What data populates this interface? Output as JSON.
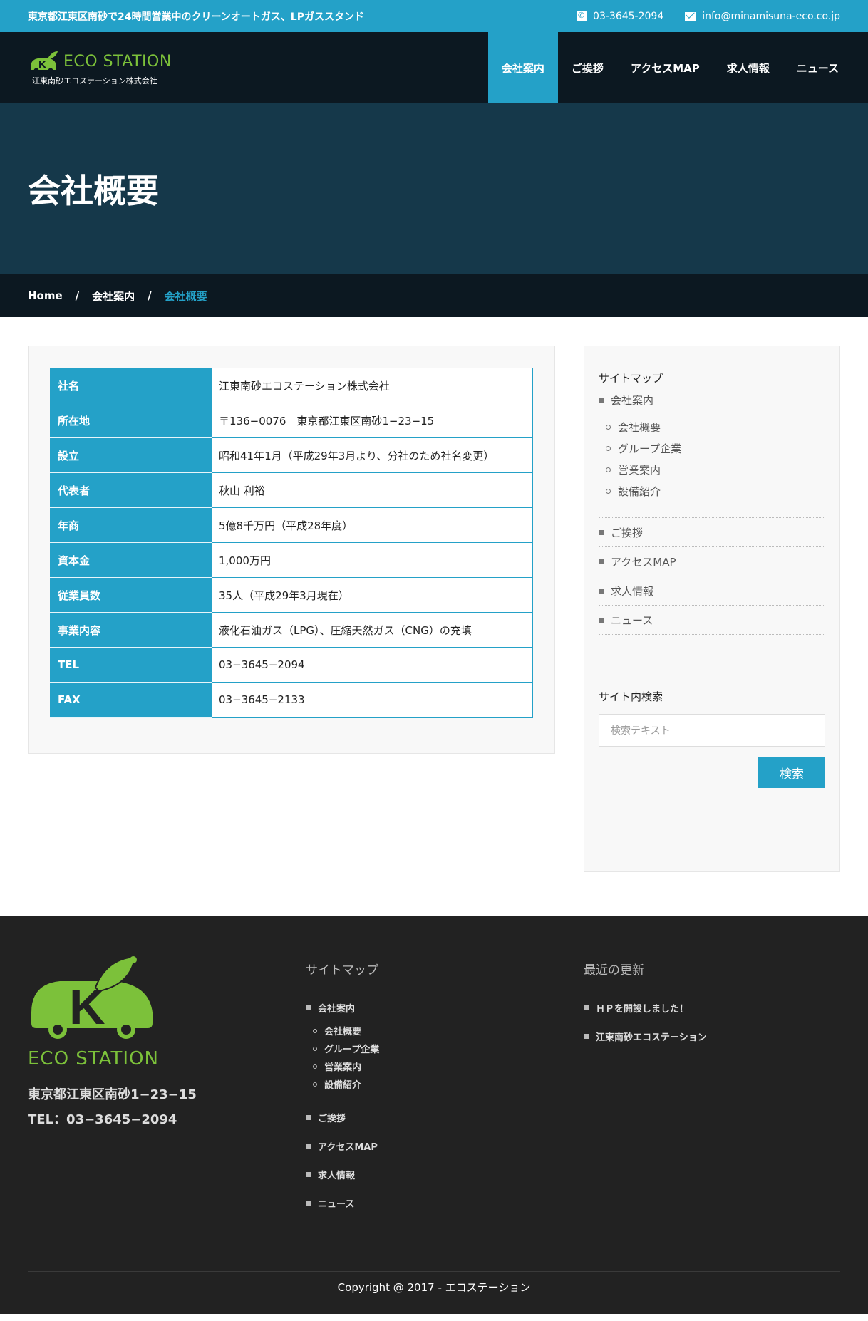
{
  "topbar": {
    "tagline": "東京都江東区南砂で24時間営業中のクリーンオートガス、LPガススタンド",
    "phone": "03-3645-2094",
    "email": "info@minamisuna-eco.co.jp"
  },
  "header": {
    "logo_text": "ECO STATION",
    "logo_sub": "江東南砂エコステーション株式会社",
    "menu": [
      {
        "label": "会社案内"
      },
      {
        "label": "ご挨拶"
      },
      {
        "label": "アクセスMAP"
      },
      {
        "label": "求人情報"
      },
      {
        "label": "ニュース"
      }
    ]
  },
  "hero": {
    "title": "会社概要"
  },
  "breadcrumb": {
    "home": "Home",
    "parent": "会社案内",
    "current": "会社概要",
    "separator": "/"
  },
  "company_table": [
    {
      "key": "社名",
      "value": "江東南砂エコステーション株式会社"
    },
    {
      "key": "所在地",
      "value": "〒136−0076　東京都江東区南砂1−23−15"
    },
    {
      "key": "設立",
      "value": "昭和41年1月（平成29年3月より、分社のため社名変更）"
    },
    {
      "key": "代表者",
      "value": "秋山 利裕"
    },
    {
      "key": "年商",
      "value": "5億8千万円（平成28年度）"
    },
    {
      "key": "資本金",
      "value": "1,000万円"
    },
    {
      "key": "従業員数",
      "value": "35人（平成29年3月現在）"
    },
    {
      "key": "事業内容",
      "value": "液化石油ガス（LPG）、圧縮天然ガス（CNG）の充填"
    },
    {
      "key": "TEL",
      "value": "03−3645−2094"
    },
    {
      "key": "FAX",
      "value": "03−3645−2133"
    }
  ],
  "sidebar": {
    "sitemap_title": "サイトマップ",
    "first_item": "会社案内",
    "sub_items": [
      "会社概要",
      "グループ企業",
      "営業案内",
      "設備紹介"
    ],
    "items": [
      "ご挨拶",
      "アクセスMAP",
      "求人情報",
      "ニュース"
    ],
    "search_title": "サイト内検索",
    "search_placeholder": "検索テキスト",
    "search_button": "検索"
  },
  "footer": {
    "logo_text": "ECO STATION",
    "address": "東京都江東区南砂1−23−15",
    "tel": "TEL：03−3645−2094",
    "sitemap_title": "サイトマップ",
    "first_item": "会社案内",
    "sub_items": [
      "会社概要",
      "グループ企業",
      "営業案内",
      "設備紹介"
    ],
    "items": [
      "ご挨拶",
      "アクセスMAP",
      "求人情報",
      "ニュース"
    ],
    "recent_title": "最近の更新",
    "recent_items": [
      "ＨＰを開設しました！",
      "江東南砂エコステーション"
    ],
    "copyright": "Copyright @ 2017 - エコステーション"
  },
  "colors": {
    "accent": "#24a1c8",
    "nav_bg": "#0c1821",
    "hero_bg": "#15384a",
    "logo_green": "#7cc13a",
    "footer_bg": "#222222"
  }
}
